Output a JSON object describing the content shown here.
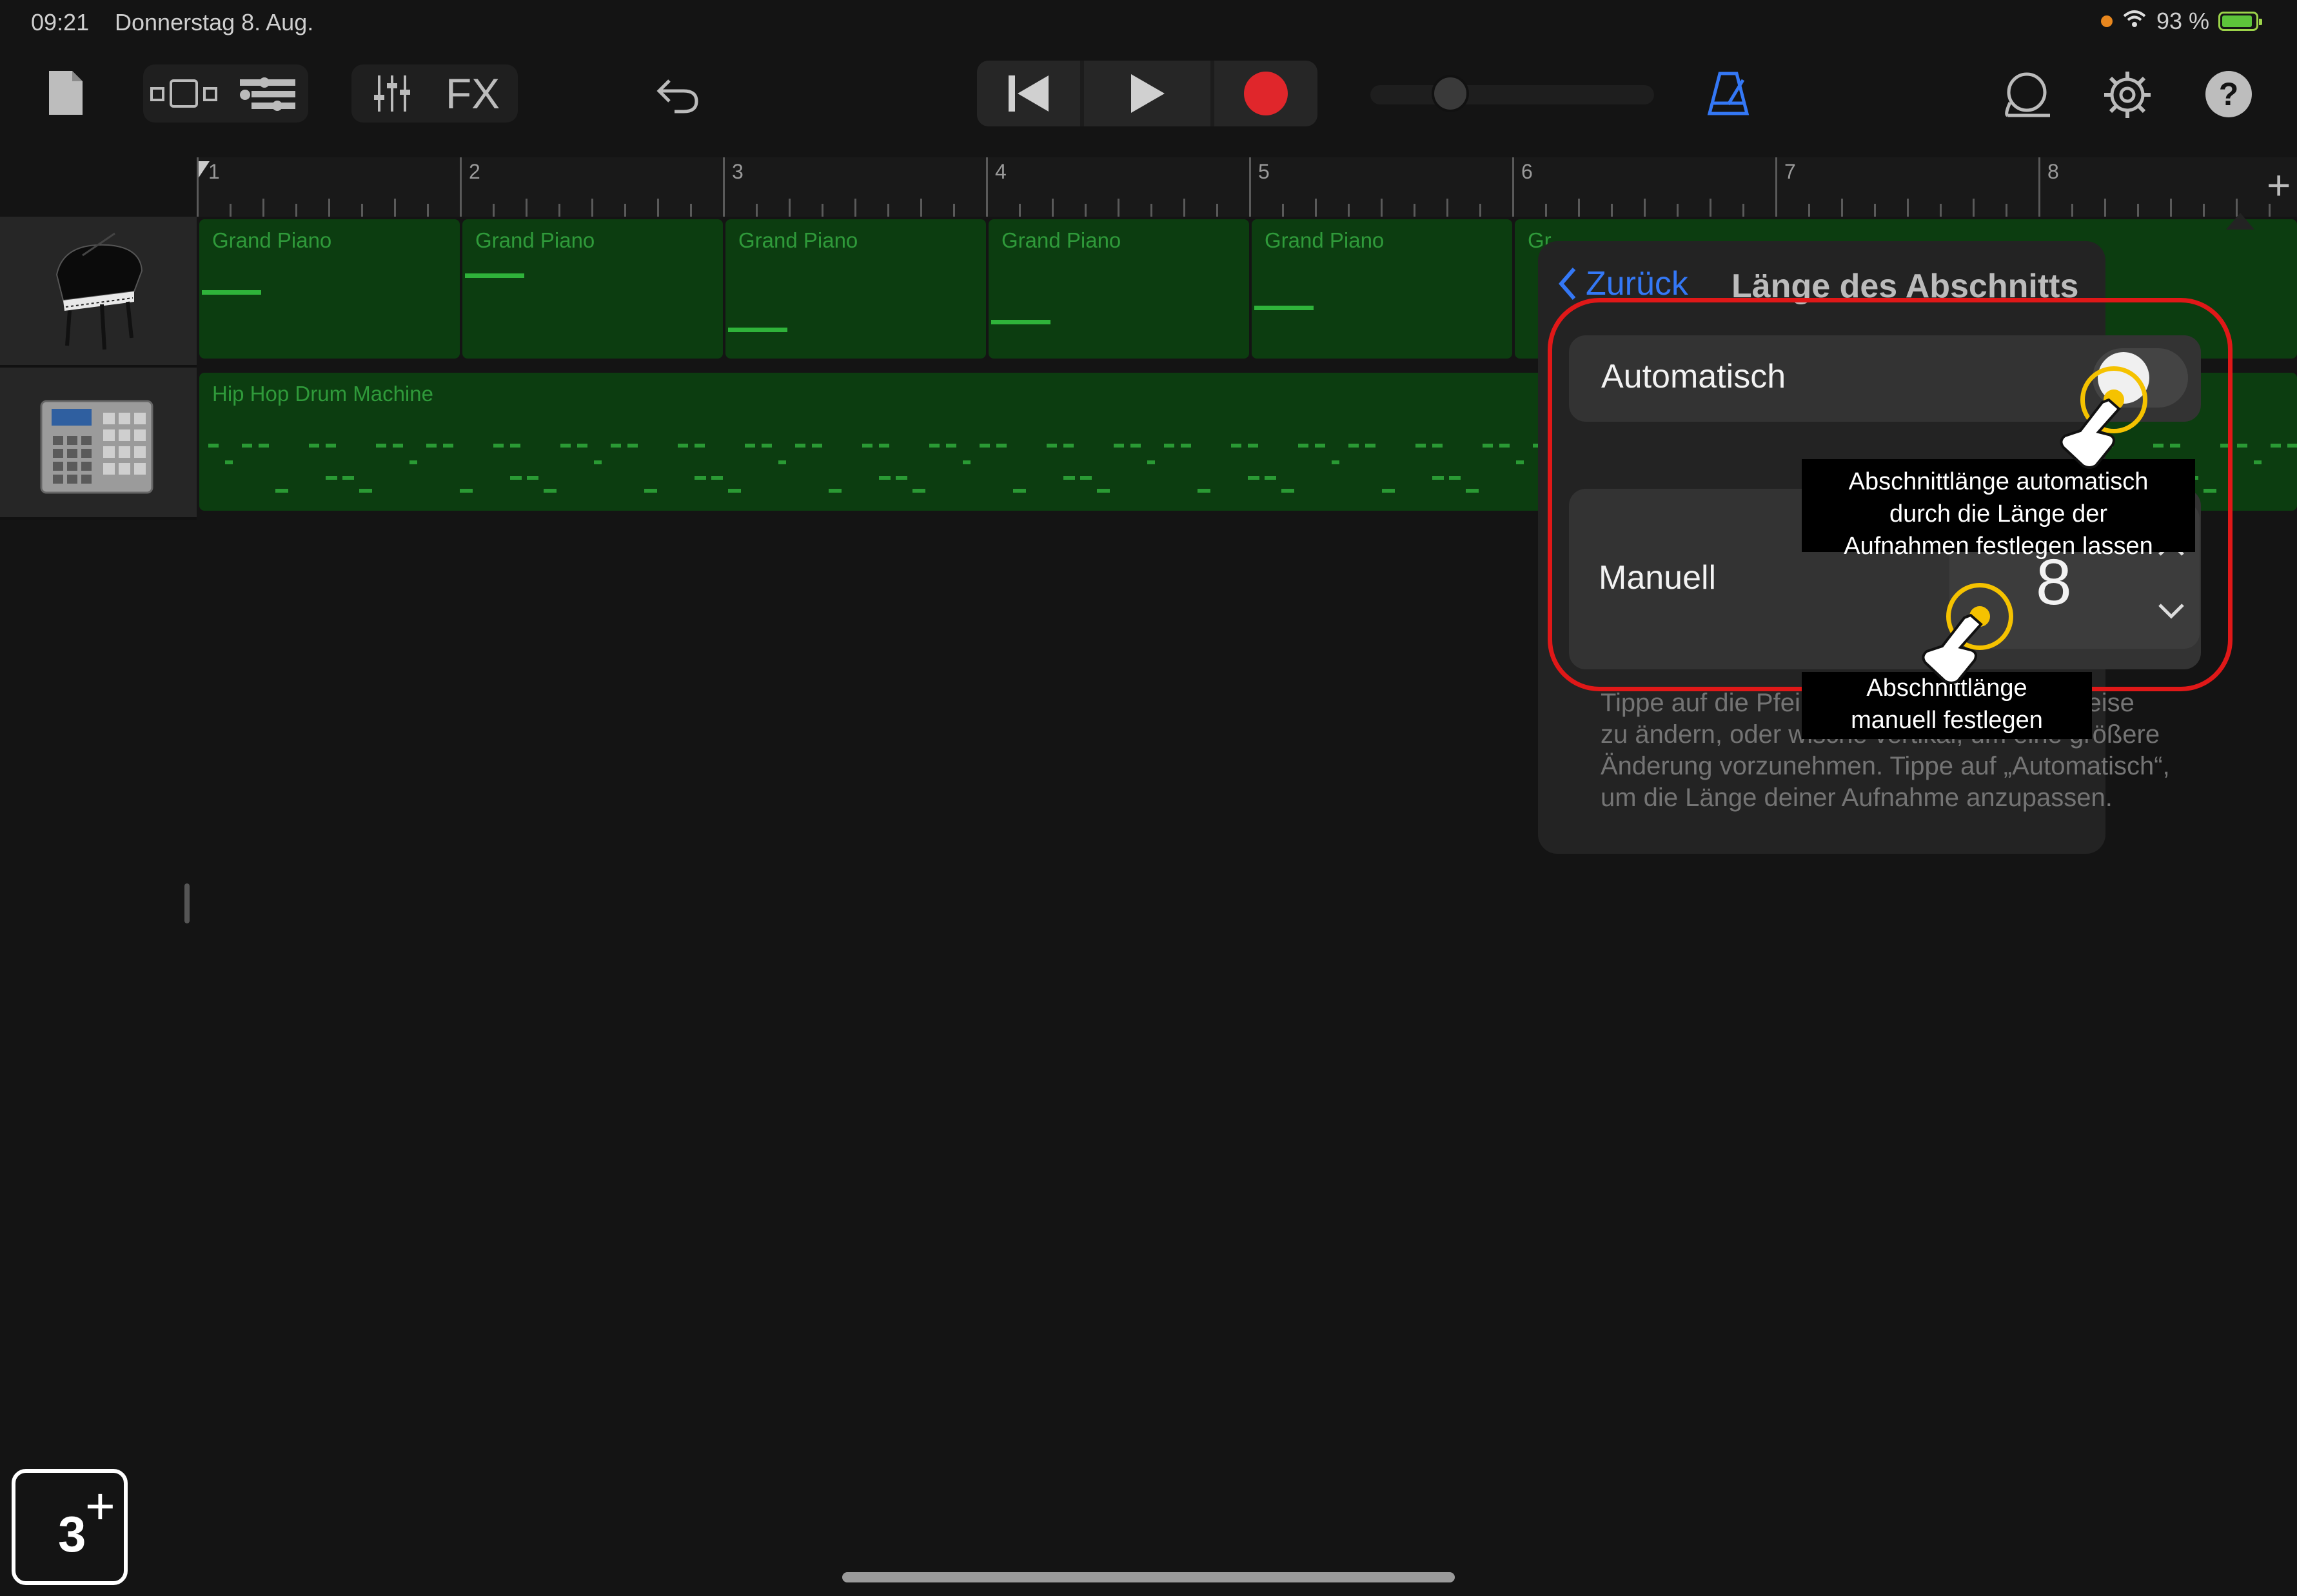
{
  "status_bar": {
    "time": "09:21",
    "date": "Donnerstag 8. Aug.",
    "battery": "93 %"
  },
  "toolbar": {
    "icons": [
      "document-icon",
      "views-icon",
      "track-controls-icon",
      "mixer-icon",
      "fx-label",
      "undo-icon",
      "rewind-icon",
      "play-icon",
      "record-icon",
      "volume-slider",
      "metronome-icon",
      "loop-icon",
      "settings-icon",
      "help-icon"
    ],
    "fx_label": "FX",
    "help_label": "?"
  },
  "ruler": {
    "bars": [
      "1",
      "2",
      "3",
      "4",
      "5",
      "6",
      "7",
      "8"
    ],
    "add_label": "+"
  },
  "tracks": [
    {
      "name": "Grand Piano",
      "icon": "grand-piano-icon",
      "regions": [
        "Grand Piano",
        "Grand Piano",
        "Grand Piano",
        "Grand Piano",
        "Grand Piano",
        "Gr"
      ]
    },
    {
      "name": "Hip Hop Drum Machine",
      "icon": "drum-machine-icon",
      "regions": [
        "Hip Hop Drum Machine"
      ]
    }
  ],
  "popover": {
    "back_label": "Zurück",
    "title": "Länge des Abschnitts",
    "automatic_label": "Automatisch",
    "manual_label": "Manuell",
    "manual_value": "8",
    "help_text_lines": [
      "Tippe auf die Pfeile, um die Länge stufenweise",
      "zu ändern, oder wische vertikal, um eine größere",
      "Änderung vorzunehmen. Tippe auf „Automatisch“,",
      "um die Länge deiner Aufnahme anzupassen."
    ]
  },
  "callouts": {
    "automatic_lines": [
      "Abschnittlänge automatisch",
      "durch die Länge der",
      "Aufnahmen festlegen lassen"
    ],
    "manual_lines": [
      "Abschnittlänge",
      "manuell festlegen"
    ]
  },
  "step_badge": {
    "number": "3",
    "plus": "+"
  },
  "colors": {
    "accent_blue": "#3478f6",
    "region_green": "#0c3d10",
    "note_green": "#2fb33a",
    "record_red": "#e0262b",
    "highlight_red": "#e01818",
    "tap_yellow": "#f5c200"
  }
}
